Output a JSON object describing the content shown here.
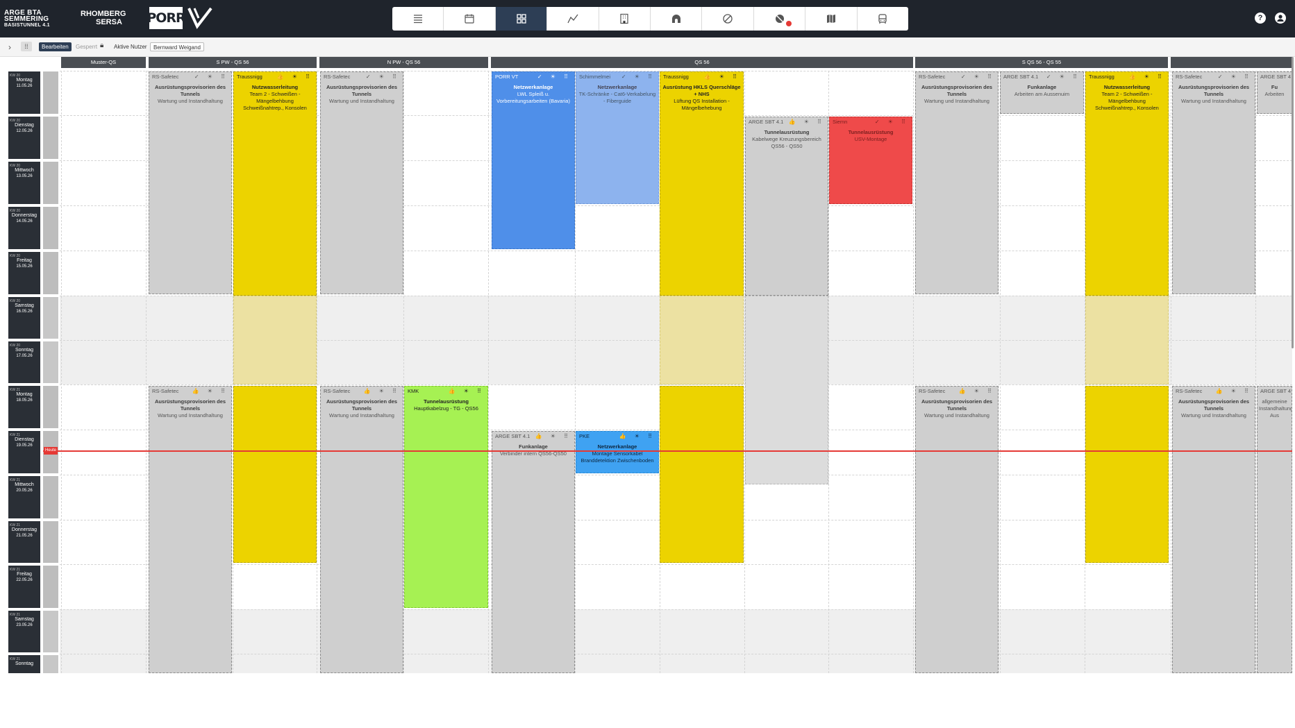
{
  "header": {
    "logo_arge_line1": "ARGE BTA",
    "logo_arge_line2": "SEMMERING",
    "logo_arge_line3": "BASISTUNNEL 4.1",
    "logo_rhomberg_line1": "RHOMBERG",
    "logo_rhomberg_line2": "SERSA",
    "logo_porr": "PORR",
    "tools": [
      {
        "icon": "list-icon"
      },
      {
        "icon": "calendar-icon"
      },
      {
        "icon": "dashboard-grid-icon",
        "active": true
      },
      {
        "icon": "chart-line-icon"
      },
      {
        "icon": "building-icon"
      },
      {
        "icon": "tunnel-icon"
      },
      {
        "icon": "prohibited-icon"
      },
      {
        "icon": "eye-off-icon",
        "badge": true
      },
      {
        "icon": "map-icon"
      },
      {
        "icon": "vehicle-icon"
      }
    ],
    "help_icon": "help-icon",
    "user_icon": "account-icon"
  },
  "filterbar": {
    "edit_label": "Bearbeiten",
    "locked_label": "Gesperrt",
    "active_users_label": "Aktive Nutzer",
    "active_user": "Bernward Weigand"
  },
  "groups": [
    {
      "label": "Muster-QS"
    },
    {
      "label": "S PW - QS 56"
    },
    {
      "label": "N PW - QS 56"
    },
    {
      "label": "QS 56"
    },
    {
      "label": "S QS 56 - QS 55"
    },
    {
      "label": ""
    }
  ],
  "days": [
    {
      "kw": "KW 20",
      "name": "Montag",
      "date": "11.05.26"
    },
    {
      "kw": "KW 20",
      "name": "Dienstag",
      "date": "12.05.26"
    },
    {
      "kw": "KW 20",
      "name": "Mittwoch",
      "date": "13.05.26"
    },
    {
      "kw": "KW 20",
      "name": "Donnerstag",
      "date": "14.05.26"
    },
    {
      "kw": "KW 20",
      "name": "Freitag",
      "date": "15.05.26"
    },
    {
      "kw": "KW 20",
      "name": "Samstag",
      "date": "16.05.26"
    },
    {
      "kw": "KW 20",
      "name": "Sonntag",
      "date": "17.05.26"
    },
    {
      "kw": "KW 21",
      "name": "Montag",
      "date": "18.05.26"
    },
    {
      "kw": "KW 21",
      "name": "Dienstag",
      "date": "19.05.26"
    },
    {
      "kw": "KW 21",
      "name": "Mittwoch",
      "date": "20.05.26"
    },
    {
      "kw": "KW 21",
      "name": "Donnerstag",
      "date": "21.05.26"
    },
    {
      "kw": "KW 21",
      "name": "Freitag",
      "date": "22.05.26"
    },
    {
      "kw": "KW 21",
      "name": "Samstag",
      "date": "23.05.26"
    },
    {
      "kw": "KW 21",
      "name": "Sonntag",
      "date": ""
    }
  ],
  "today_label": "Heute",
  "cards": [
    {
      "company": "RS-Safetec",
      "title": "Ausrüstungsprovisorien des Tunnels",
      "subtitle": "Wartung und Instandhaltung",
      "icons": "✓ ☀ ⠿"
    },
    {
      "company": "Traussnigg",
      "title": "Nutzwasserleitung",
      "subtitle": "Team 2 - Schweißen - Mängelbehbung Schweißnahtrep., Konsolen",
      "icons": "👍 ☀ ⠿"
    },
    {
      "company": "RS-Safetec",
      "title": "Ausrüstungsprovisorien des Tunnels",
      "subtitle": "Wartung und Instandhaltung",
      "icons": "✓ ☀ ⠿"
    },
    {
      "company": "PORR VT",
      "title": "Netzwerkanlage",
      "subtitle": "LWL Spleiß u. Vorbereitungsarbeiten (Bavaria)",
      "icons": "✓ ☀ ⠿"
    },
    {
      "company": "Schimmelmei",
      "title": "Netzwerkanlage",
      "subtitle": "TK-Schränke - Cat6-Verkabelung - Fiberguide",
      "icons": "✓ ☀ ⠿"
    },
    {
      "company": "Traussnigg",
      "title": "Ausrüstung HKLS Querschläge + NHS",
      "subtitle": "Lüftung QS Installation - Mängelbehebung",
      "icons": "👍 ☀ ⠿"
    },
    {
      "company": "ARGE SBT 4.1",
      "title": "Tunnelausrüstung",
      "subtitle": "Kabelwege Kreuzungsbereich QS56 - QS50",
      "icons": "👍 ☀ ⠿"
    },
    {
      "company": "Siemn",
      "title": "Tunnelausrüstung",
      "subtitle": "USV-Montage",
      "icons": "✓ ☀ ⠿"
    },
    {
      "company": "RS-Safetec",
      "title": "Ausrüstungsprovisorien des Tunnels",
      "subtitle": "Wartung und Instandhaltung",
      "icons": "✓ ☀ ⠿"
    },
    {
      "company": "ARGE SBT 4.1",
      "title": "Funkanlage",
      "subtitle": "Arbeiten am Aussenuim",
      "icons": "✓ ☀ ⠿"
    },
    {
      "company": "Traussnigg",
      "title": "Nutzwasserleitung",
      "subtitle": "Team 2 - Schweißen - Mängelbehbung Schweißnahtrep., Konsolen",
      "icons": "👍 ☀ ⠿"
    },
    {
      "company": "RS-Safetec",
      "title": "Ausrüstungsprovisorien des Tunnels",
      "subtitle": "Wartung und Instandhaltung",
      "icons": "✓ ☀ ⠿"
    },
    {
      "company": "ARGE SBT 4",
      "title": "Fu",
      "subtitle": "Arbeiten",
      "icons": ""
    },
    {
      "company": "RS-Safetec",
      "title": "Ausrüstungsprovisorien des Tunnels",
      "subtitle": "Wartung und Instandhaltung",
      "icons": "👍 ☀ ⠿"
    },
    {
      "company": "RS-Safetec",
      "title": "Ausrüstungsprovisorien des Tunnels",
      "subtitle": "Wartung und Instandhaltung",
      "icons": "👍 ☀ ⠿"
    },
    {
      "company": "KMK",
      "title": "Tunnelausrüstung",
      "subtitle": "Hauptkabelzug - TG - QS56",
      "icons": "👍 ☀ ⠿"
    },
    {
      "company": "ARGE SBT 4.1",
      "title": "Funkanlage",
      "subtitle": "Verbinder intern QS56-QS50",
      "icons": "👍 ☀ ⠿"
    },
    {
      "company": "PKE",
      "title": "Netzwerkanlage",
      "subtitle": "Montage Sensorkabel Branddetektion Zwischenboden",
      "icons": "👍 ☀ ⠿"
    },
    {
      "company": "RS-Safetec",
      "title": "Ausrüstungsprovisorien des Tunnels",
      "subtitle": "Wartung und Instandhaltung",
      "icons": "👍 ☀ ⠿"
    },
    {
      "company": "RS-Safetec",
      "title": "Ausrüstungsprovisorien des Tunnels",
      "subtitle": "Wartung und Instandhaltung",
      "icons": "👍 ☀ ⠿"
    },
    {
      "company": "ARGE SBT 4",
      "title": "",
      "subtitle": "allgemeine Instandhaltung Aus",
      "icons": ""
    }
  ],
  "colors": {
    "yellow": "#ecd300",
    "grey": "#cfcfcf",
    "blue": "#4f8fe9",
    "light_blue": "#8db3ee",
    "red": "#ef4a4a",
    "green": "#a6f153",
    "cyan": "#3fa2f2",
    "today_line": "#e53935",
    "header_bg": "#1f242c"
  }
}
